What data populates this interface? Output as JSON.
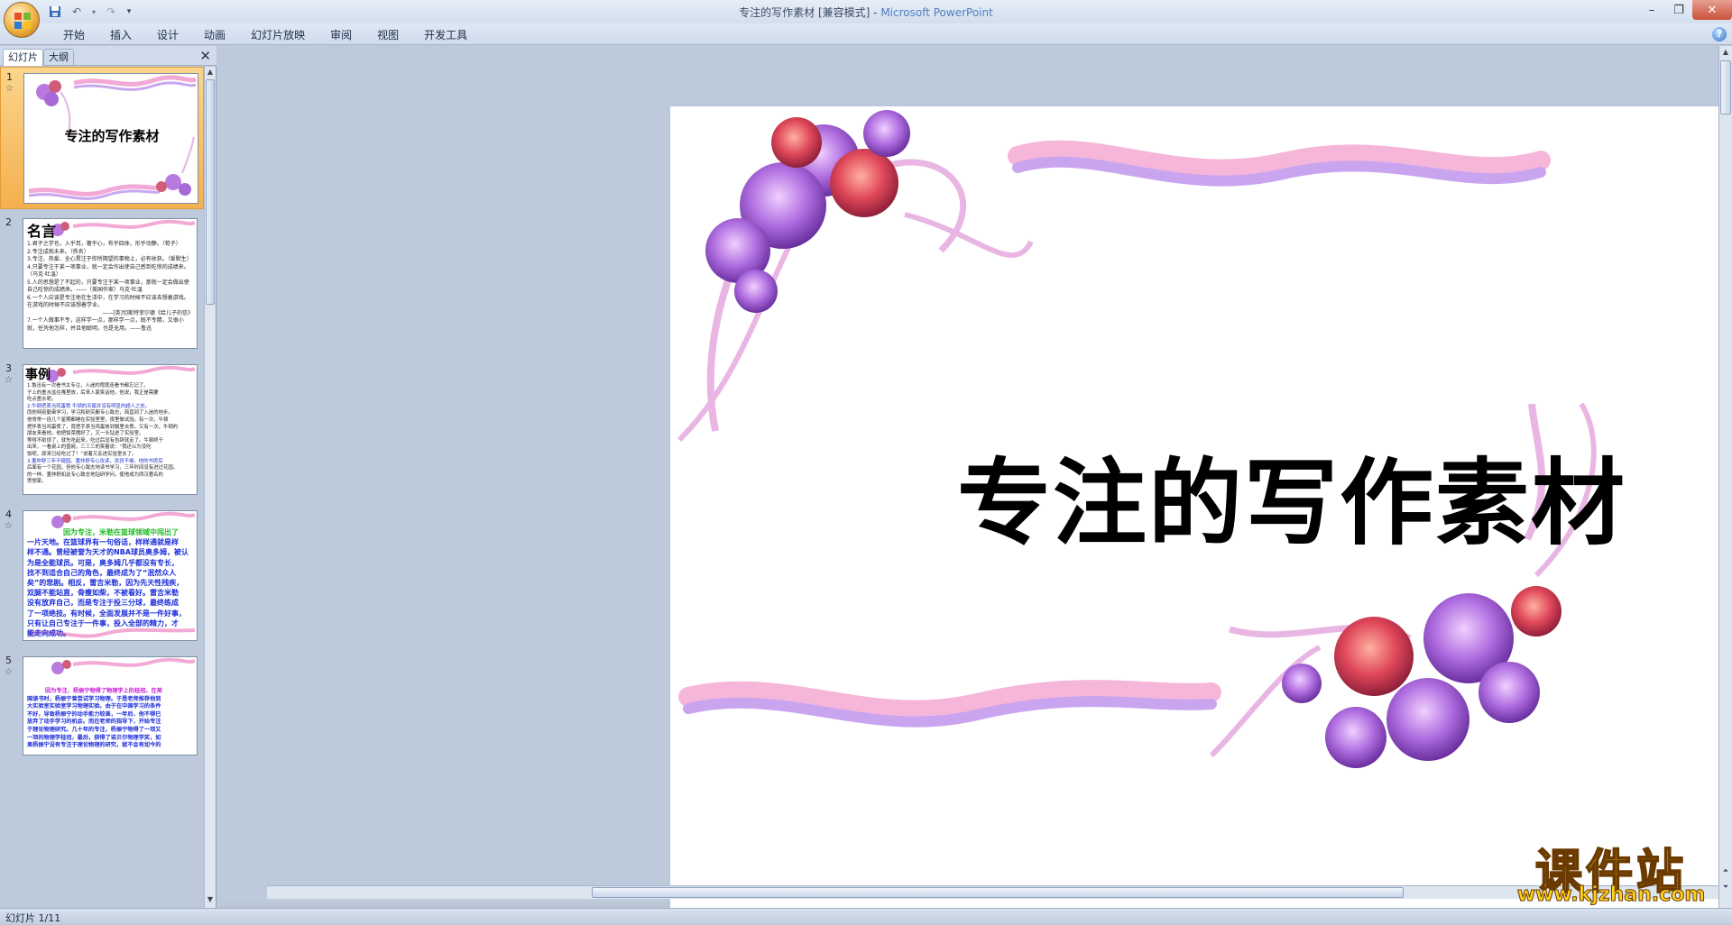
{
  "window": {
    "title_doc": "专注的写作素材 [兼容模式]",
    "title_sep": " - ",
    "title_app": "Microsoft PowerPoint"
  },
  "ribbon": {
    "tabs": [
      "开始",
      "插入",
      "设计",
      "动画",
      "幻灯片放映",
      "审阅",
      "视图",
      "开发工具"
    ],
    "help": "?"
  },
  "panel": {
    "tab_slides": "幻灯片",
    "tab_outline": "大纲",
    "close": "✕"
  },
  "thumbnails": [
    {
      "num": "1",
      "title": "专注的写作素材"
    },
    {
      "num": "2",
      "heading": "名言",
      "lines": [
        "1.君子之学也，入乎耳，箸乎心，布乎四体，形乎动静。（荀子）",
        "2.专注成就未来。（佚名）",
        "3.专注、热爱、全心贯注于你所期望的事物上，必有收获。（爱默生）",
        "4.只要专注于某一项事业，就一定会作出使自己感到吃惊的成绩来。（马克·吐温）",
        "5.人的思想是了不起的，只要专注于某一项事业，那就一定会做出使自己吃惊的成绩来。——（美国作家）马克·吐温",
        "6.一个人应该是专注地在生活中，在学习的时候不应该去想着游戏。在游戏的时候不应该想着学业。",
        "——[英]切斯特菲尔德《给儿子的信》",
        "7.一个人做事不专，这样学一点，那样学一点，既不专精，又很小就，任凭他怎样，并且他聪明，也是无用。——鲁迅"
      ]
    },
    {
      "num": "3",
      "heading": "事例",
      "lines": [
        "1.鲁迅有一次看书太专注，入迷的程度连看书都忘记了。",
        "子上的墨水盆往嘴里放，后来人家笑话他，他说，我正是需要",
        "吃点墨水呢。",
        "2.牛顿把表当鸡蛋煮 牛顿的天赋并没有明显的超人之处。",
        "而他特别勤奋学习，学习和研究都专心致志，简直到了入迷的地步。",
        "他常常一连几个星期都睡在实验室里，夜里做试验。有一次，牛顿",
        "把怀表当鸡蛋煮了，竟把手表当鸡蛋放到锅里去煮。又有一次，牛顿的",
        "朋友来看他，他把饭菜摆好了，又一头钻进了实验室。",
        "等得不耐烦了，就先吃起来。吃过后没有告辞就走了。牛顿终于",
        "出来，一看桌上的盘碗，三三三的笑着说：“我还以为没吃",
        "饭呢，原来已经吃过了！”说着又走进实验室去了。",
        "3.董仲舒三年不窥园。董仲舒专心攻读，孜孜不倦。他的书房后",
        "后面有一个花园，但他专心致志地读书学习，三年时间没有进过花园。",
        "的一样。董仲舒如此专心致志地钻研学问，使他成为西汉著名的",
        "思想家。"
      ]
    },
    {
      "num": "4",
      "lines": [
        "因为专注，米勒在篮球领域中闯出了",
        "一片天地。在篮球界有一句俗话，样样通就是样",
        "样不通。曾经被誉为天才的NBA球员奥多姆，被认",
        "为是全能球员。可是，奥多姆几乎都没有专长，",
        "找不到适合自己的角色，最终成为了“泯然众人",
        "矣”的悲剧。相反，雷吉米勒，因为先天性残疾，",
        "双腿不能站直，骨瘦如柴，不被看好。雷吉米勒",
        "没有放弃自己，而是专注于投三分球，最终练成",
        "了一项绝技。有时候，全面发展并不是一件好事，",
        "只有让自己专注于一件事，投入全部的精力，才",
        "能走向成功。"
      ]
    },
    {
      "num": "5",
      "lines": [
        "因为专注，杨振宁物得了物理学上的桂冠。在美",
        "国读书时，杨振宁曾尝试学习物理。于是老师推荐他到",
        "大实验室实验室学习物理实验。由于在中国学习的条件",
        "不好，导致杨振宁的动手能力较差，一年后，他不得已",
        "放弃了动手学习的机会。而在老师的指导下，开始专注",
        "于理论物理研究。几十年的专注，杨振宁物得了一项又",
        "一项的物理学桂冠，最后，获得了诺贝尔物理学奖，如",
        "果杨振宁没有专注于理论物理的研究，就不会有如今的"
      ]
    }
  ],
  "slide": {
    "title": "专注的写作素材"
  },
  "status": {
    "text": "幻灯片 1/11"
  },
  "watermark": {
    "brand": "课件站",
    "url": "www.kjzhan.com"
  }
}
